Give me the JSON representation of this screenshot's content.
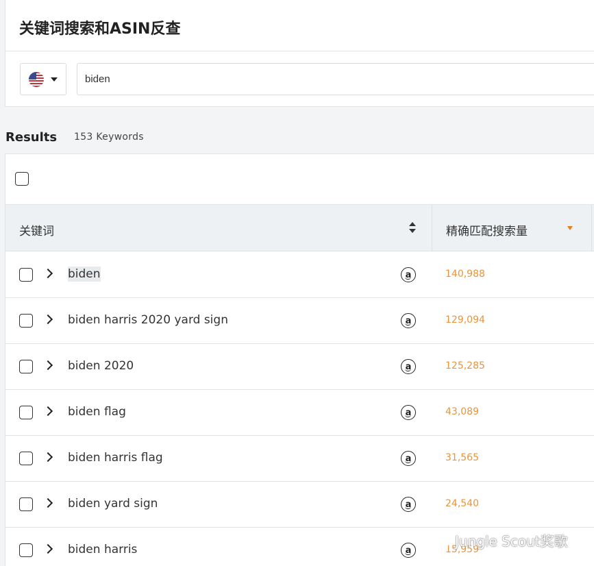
{
  "header": {
    "title": "关键词搜索和ASIN反查"
  },
  "search": {
    "country_icon": "us-flag-icon",
    "value": "biden"
  },
  "results": {
    "label": "Results",
    "count": "153 Keywords"
  },
  "table": {
    "columns": [
      {
        "label": "关键词"
      },
      {
        "label": "精确匹配搜索量"
      }
    ],
    "rows": [
      {
        "keyword": "biden",
        "volume": "140,988"
      },
      {
        "keyword": "biden harris 2020 yard sign",
        "volume": "129,094"
      },
      {
        "keyword": "biden 2020",
        "volume": "125,285"
      },
      {
        "keyword": "biden flag",
        "volume": "43,089"
      },
      {
        "keyword": "biden harris flag",
        "volume": "31,565"
      },
      {
        "keyword": "biden yard sign",
        "volume": "24,540"
      },
      {
        "keyword": "biden harris",
        "volume": "15,959"
      }
    ]
  },
  "watermark": {
    "text": "Jungle Scout奖歌"
  },
  "colors": {
    "volume": "#e8943a",
    "sort_active": "#e67e22",
    "header_bg": "#eef1f3"
  }
}
